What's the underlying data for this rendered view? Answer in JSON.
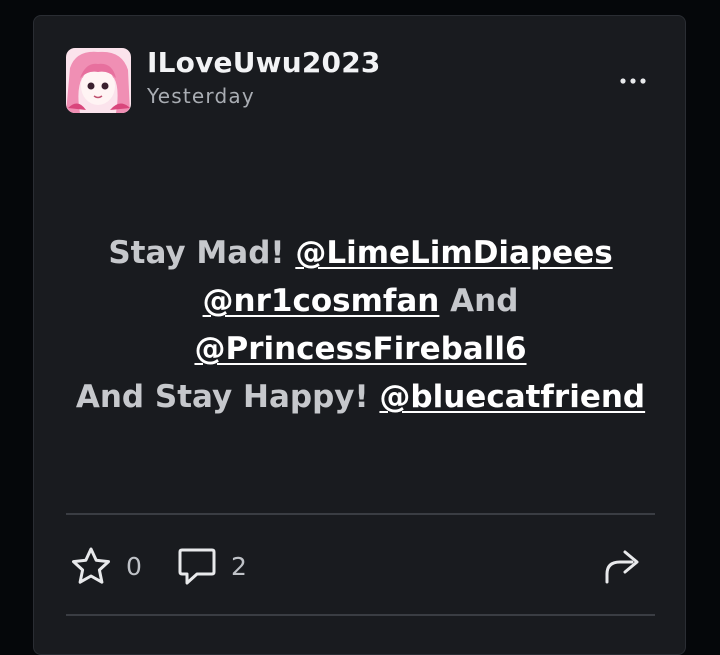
{
  "post": {
    "author": "ILoveUwu2023",
    "timestamp": "Yesterday",
    "body": [
      [
        {
          "t": "Stay Mad! ",
          "m": false
        },
        {
          "t": "@LimeLimDiapees",
          "m": true
        }
      ],
      [
        {
          "t": "@nr1cosmfan",
          "m": true
        },
        {
          "t": " And",
          "m": false
        }
      ],
      [
        {
          "t": "@PrincessFireball6",
          "m": true
        }
      ],
      [
        {
          "t": "And Stay Happy! ",
          "m": false
        },
        {
          "t": "@bluecatfriend",
          "m": true
        }
      ]
    ]
  },
  "actions": {
    "favorite": {
      "icon": "star-icon",
      "count": "0"
    },
    "comment": {
      "icon": "comment-icon",
      "count": "2"
    },
    "share": {
      "icon": "share-icon"
    }
  },
  "colors": {
    "card": "#191b1f",
    "text": "#c6c8cc",
    "mention": "#ffffff",
    "avatar_pink": "#f3a9c5"
  }
}
